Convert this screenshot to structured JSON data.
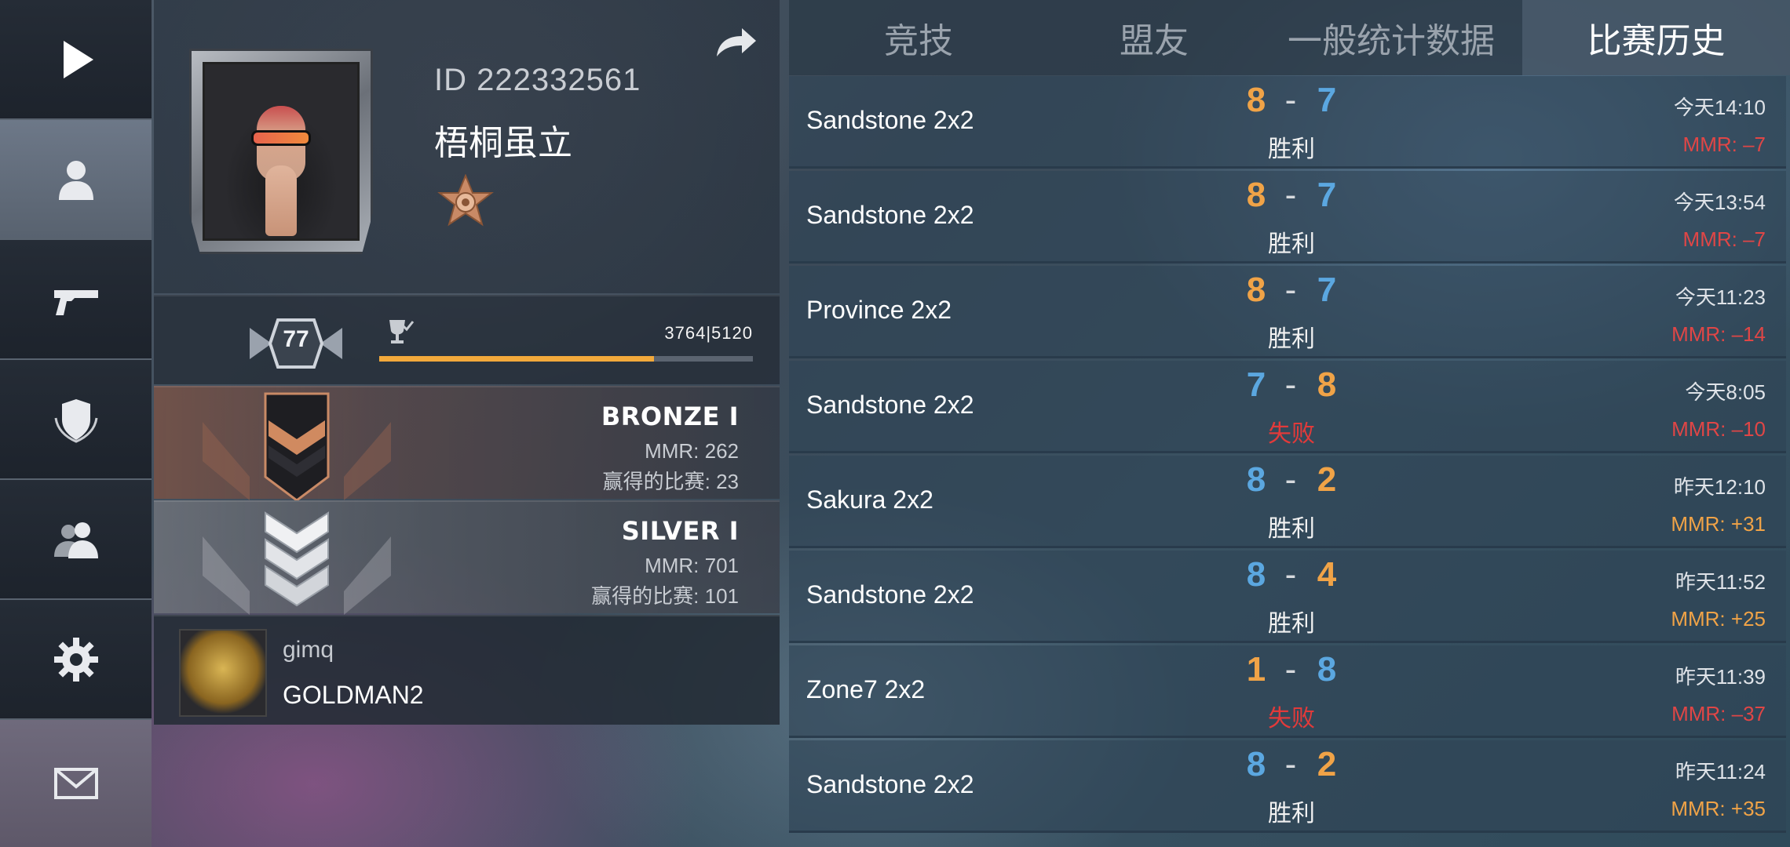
{
  "nav": {
    "items": [
      {
        "name": "play-icon"
      },
      {
        "name": "profile-icon"
      },
      {
        "name": "pistol-icon"
      },
      {
        "name": "shield-icon"
      },
      {
        "name": "friends-icon"
      },
      {
        "name": "gear-icon"
      },
      {
        "name": "mail-icon"
      }
    ]
  },
  "profile": {
    "id_text": "ID 222332561",
    "name": "梧桐虽立",
    "level": "77",
    "xp_text": "3764|5120",
    "xp_fraction": 0.735
  },
  "ranks": [
    {
      "title": "BRONZE I",
      "mmr": "MMR: 262",
      "wins": "赢得的比赛: 23"
    },
    {
      "title": "SILVER I",
      "mmr": "MMR: 701",
      "wins": "赢得的比赛: 101"
    }
  ],
  "clan": {
    "tag": "gimq",
    "name": "GOLDMAN2"
  },
  "tabs": [
    "竞技",
    "盟友",
    "一般统计数据",
    "比赛历史"
  ],
  "matches": [
    {
      "map": "Sandstone 2x2",
      "left": "8",
      "right": "7",
      "left_color": "orange",
      "right_color": "blue",
      "result": "胜利",
      "result_type": "win",
      "time": "今天14:10",
      "mmr": "MMR: –7",
      "mmr_type": "neg"
    },
    {
      "map": "Sandstone 2x2",
      "left": "8",
      "right": "7",
      "left_color": "orange",
      "right_color": "blue",
      "result": "胜利",
      "result_type": "win",
      "time": "今天13:54",
      "mmr": "MMR: –7",
      "mmr_type": "neg"
    },
    {
      "map": "Province 2x2",
      "left": "8",
      "right": "7",
      "left_color": "orange",
      "right_color": "blue",
      "result": "胜利",
      "result_type": "win",
      "time": "今天11:23",
      "mmr": "MMR: –14",
      "mmr_type": "neg"
    },
    {
      "map": "Sandstone 2x2",
      "left": "7",
      "right": "8",
      "left_color": "blue",
      "right_color": "orange",
      "result": "失败",
      "result_type": "loss",
      "time": "今天8:05",
      "mmr": "MMR: –10",
      "mmr_type": "neg"
    },
    {
      "map": "Sakura 2x2",
      "left": "8",
      "right": "2",
      "left_color": "blue",
      "right_color": "orange",
      "result": "胜利",
      "result_type": "win",
      "time": "昨天12:10",
      "mmr": "MMR: +31",
      "mmr_type": "pos"
    },
    {
      "map": "Sandstone 2x2",
      "left": "8",
      "right": "4",
      "left_color": "blue",
      "right_color": "orange",
      "result": "胜利",
      "result_type": "win",
      "time": "昨天11:52",
      "mmr": "MMR: +25",
      "mmr_type": "pos"
    },
    {
      "map": "Zone7 2x2",
      "left": "1",
      "right": "8",
      "left_color": "orange",
      "right_color": "blue",
      "result": "失败",
      "result_type": "loss",
      "time": "昨天11:39",
      "mmr": "MMR: –37",
      "mmr_type": "neg"
    },
    {
      "map": "Sandstone 2x2",
      "left": "8",
      "right": "2",
      "left_color": "blue",
      "right_color": "orange",
      "result": "胜利",
      "result_type": "win",
      "time": "昨天11:24",
      "mmr": "MMR: +35",
      "mmr_type": "pos"
    }
  ],
  "colors": {
    "accent_orange": "#f0a347",
    "accent_blue": "#5ba7e0",
    "loss_red": "#e23a3a",
    "xp_bar": "#f2a93b"
  }
}
